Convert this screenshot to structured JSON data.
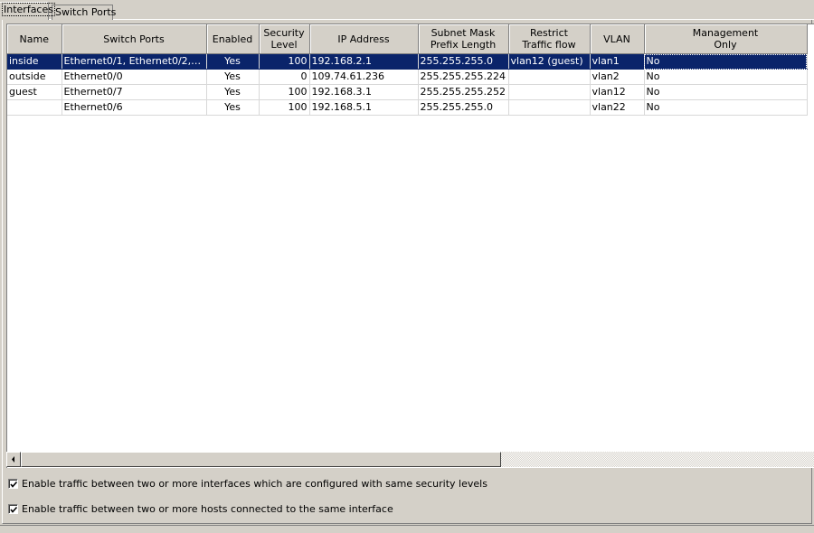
{
  "tabs": [
    {
      "label": "Interfaces",
      "active": true
    },
    {
      "label": "Switch Ports",
      "active": false
    }
  ],
  "table": {
    "columns": [
      "Name",
      "Switch Ports",
      "Enabled",
      "Security\nLevel",
      "IP Address",
      "Subnet Mask\nPrefix Length",
      "Restrict\nTraffic flow",
      "VLAN",
      "Management\nOnly"
    ],
    "rows": [
      {
        "selected": true,
        "cells": [
          "inside",
          "Ethernet0/1, Ethernet0/2, Et...",
          "Yes",
          "100",
          "192.168.2.1",
          "255.255.255.0",
          "vlan12 (guest)",
          "vlan1",
          "No"
        ]
      },
      {
        "selected": false,
        "cells": [
          "outside",
          "Ethernet0/0",
          "Yes",
          "0",
          "109.74.61.236",
          "255.255.255.224",
          "",
          "vlan2",
          "No"
        ]
      },
      {
        "selected": false,
        "cells": [
          "guest",
          "Ethernet0/7",
          "Yes",
          "100",
          "192.168.3.1",
          "255.255.255.252",
          "",
          "vlan12",
          "No"
        ]
      },
      {
        "selected": false,
        "cells": [
          "",
          "Ethernet0/6",
          "Yes",
          "100",
          "192.168.5.1",
          "255.255.255.0",
          "",
          "vlan22",
          "No"
        ]
      }
    ]
  },
  "options": [
    {
      "label": "Enable traffic between two or more interfaces which are configured with same security levels",
      "checked": true
    },
    {
      "label": "Enable traffic between two or more hosts connected to the same interface",
      "checked": true
    }
  ],
  "colors": {
    "selection": "#0a246a",
    "window": "#d4d0c8"
  }
}
